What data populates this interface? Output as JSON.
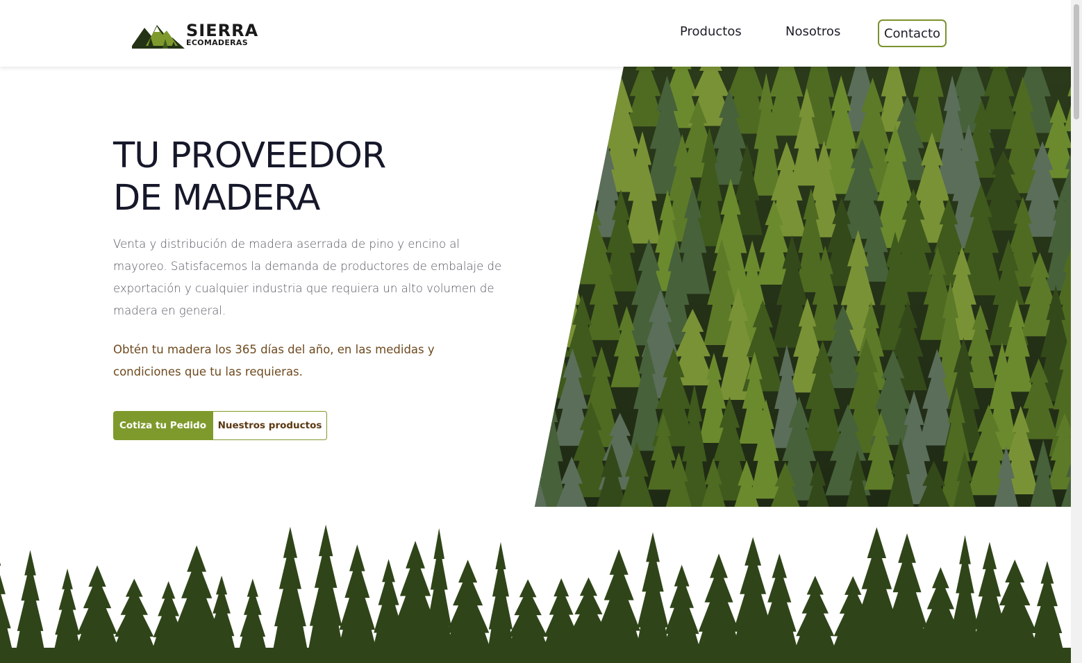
{
  "header": {
    "logo": {
      "title": "SIERRA",
      "subtitle": "ECOMADERAS"
    },
    "nav": {
      "productos": "Productos",
      "nosotros": "Nosotros",
      "contacto": "Contacto"
    }
  },
  "hero": {
    "title": "TU PROVEEDOR\nDE MADERA",
    "description": "Venta y distribución de madera aserrada de pino y encino al mayoreo. Satisfacemos la demanda de productores de embalaje de exportación y cualquier industria que requiera un alto volumen de madera en general.",
    "note": "Obtén tu madera los 365 días del año, en las medidas y condiciones que tu las requieras.",
    "buttons": {
      "primary": "Cotiza tu Pedido",
      "secondary": "Nuestros productos"
    }
  },
  "colors": {
    "accent_green": "#7f9a2c",
    "brown_text": "#6e4a1f",
    "dark_forest": "#2f4519",
    "title_text": "#16182a"
  },
  "icons": {
    "logo": "mountains-trees-logo-icon",
    "hero_image": "pine-forest-image",
    "footer_decor": "treeline-silhouette"
  }
}
